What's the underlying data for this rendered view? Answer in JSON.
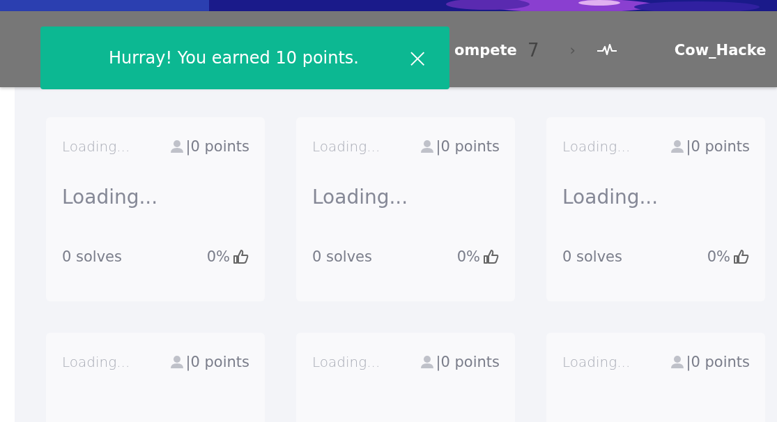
{
  "toast": {
    "message": "Hurray! You earned 10 points.",
    "close": "×"
  },
  "nav": {
    "items": [
      {
        "label": "ompete"
      },
      {
        "label": "7"
      },
      {
        "label": "›"
      }
    ],
    "user": "Cow_Hacke"
  },
  "cards": [
    {
      "category": "Loading...",
      "points": "|0 points",
      "title": "Loading...",
      "solves": "0 solves",
      "rating": "0%"
    },
    {
      "category": "Loading...",
      "points": "|0 points",
      "title": "Loading...",
      "solves": "0 solves",
      "rating": "0%"
    },
    {
      "category": "Loading...",
      "points": "|0 points",
      "title": "Loading...",
      "solves": "0 solves",
      "rating": "0%"
    },
    {
      "category": "Loading...",
      "points": "|0 points"
    },
    {
      "category": "Loading...",
      "points": "|0 points"
    },
    {
      "category": "Loading...",
      "points": "|0 points"
    }
  ]
}
